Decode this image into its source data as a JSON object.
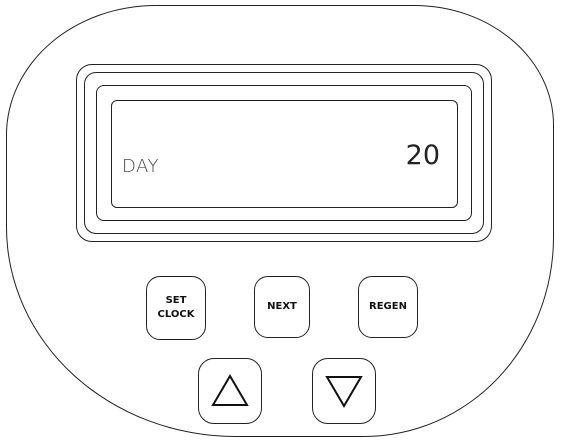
{
  "display": {
    "label": "DAY",
    "value": "20"
  },
  "buttons": {
    "set_clock": "SET\nCLOCK",
    "next": "NEXT",
    "regen": "REGEN",
    "up_icon": "triangle-up-icon",
    "down_icon": "triangle-down-icon"
  }
}
